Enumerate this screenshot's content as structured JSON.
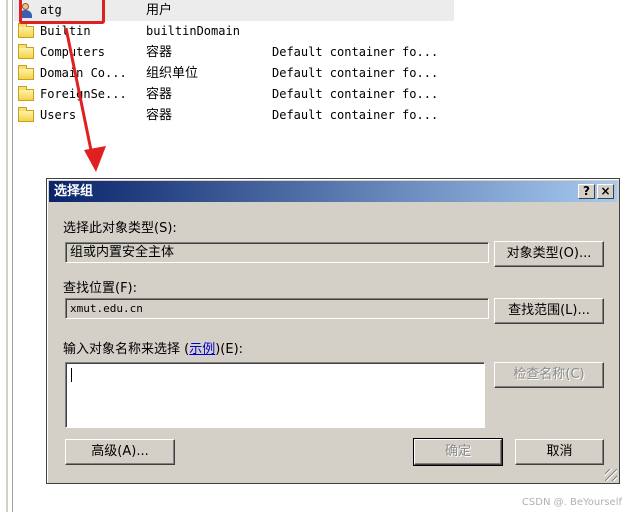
{
  "objects": [
    {
      "name": "atg",
      "type": "用户",
      "description": "",
      "icon": "user-icon",
      "selected": true
    },
    {
      "name": "Builtin",
      "type": "builtinDomain",
      "description": "",
      "icon": "folder-icon"
    },
    {
      "name": "Computers",
      "type": "容器",
      "description": "Default container fo...",
      "icon": "folder-icon"
    },
    {
      "name": "Domain Co...",
      "type": "组织单位",
      "description": "Default container fo...",
      "icon": "folder-icon"
    },
    {
      "name": "ForeignSe...",
      "type": "容器",
      "description": "Default container fo...",
      "icon": "folder-icon"
    },
    {
      "name": "Users",
      "type": "容器",
      "description": "Default container fo...",
      "icon": "folder-icon"
    }
  ],
  "dialog": {
    "title": "选择组",
    "help_label": "?",
    "close_label": "×",
    "object_type_label": "选择此对象类型(S):",
    "object_type_value": "组或内置安全主体",
    "object_types_button": "对象类型(O)...",
    "location_label": "查找位置(F):",
    "location_value": "xmut.edu.cn",
    "locations_button": "查找范围(L)...",
    "enter_names_label_before": "输入对象名称来选择 (",
    "examples_link": "示例",
    "enter_names_label_after": ")(E):",
    "names_value": "",
    "check_names_button": "检查名称(C)",
    "advanced_button": "高级(A)...",
    "ok_button": "确定",
    "cancel_button": "取消"
  },
  "watermark": "CSDN @. BeYourself",
  "colors": {
    "highlight": "#e02020",
    "titlebar_start": "#0a246a",
    "titlebar_end": "#a6caf0",
    "dialog_bg": "#d4d0c8"
  }
}
